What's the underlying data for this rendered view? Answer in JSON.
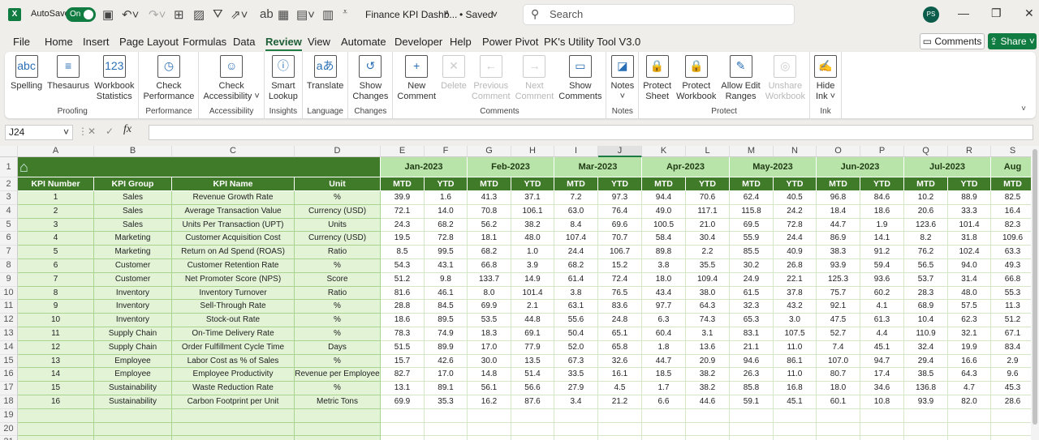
{
  "titlebar": {
    "autosave_label": "AutoSave",
    "autosave_state": "On",
    "doc_title": "Finance KPI Dashb...",
    "save_status": "• Saved",
    "search_placeholder": "Search",
    "user_initials": "PS"
  },
  "menu": [
    "File",
    "Home",
    "Insert",
    "Page Layout",
    "Formulas",
    "Data",
    "Review",
    "View",
    "Automate",
    "Developer",
    "Help",
    "Power Pivot",
    "PK's Utility Tool V3.0"
  ],
  "active_menu": "Review",
  "header_buttons": {
    "comments": "Comments",
    "share": "Share"
  },
  "ribbon": [
    {
      "label": "Proofing",
      "buttons": [
        {
          "name": "spelling",
          "text": "Spelling",
          "icon": "abc-check-icon",
          "glyph": "abc"
        },
        {
          "name": "thesaurus",
          "text": "Thesaurus",
          "icon": "book-icon",
          "glyph": "≡"
        },
        {
          "name": "workbook-statistics",
          "text": "Workbook\nStatistics",
          "icon": "statistics-icon",
          "glyph": "123"
        }
      ]
    },
    {
      "label": "Performance",
      "buttons": [
        {
          "name": "check-performance",
          "text": "Check\nPerformance",
          "icon": "grid-clock-icon",
          "glyph": "◷"
        }
      ]
    },
    {
      "label": "Accessibility",
      "buttons": [
        {
          "name": "check-accessibility",
          "text": "Check\nAccessibility ˅",
          "icon": "accessibility-icon",
          "glyph": "☺"
        }
      ]
    },
    {
      "label": "Insights",
      "buttons": [
        {
          "name": "smart-lookup",
          "text": "Smart\nLookup",
          "icon": "search-info-icon",
          "glyph": "ⓘ"
        }
      ]
    },
    {
      "label": "Language",
      "buttons": [
        {
          "name": "translate",
          "text": "Translate",
          "icon": "translate-icon",
          "glyph": "aあ"
        }
      ]
    },
    {
      "label": "Changes",
      "buttons": [
        {
          "name": "show-changes",
          "text": "Show\nChanges",
          "icon": "grid-history-icon",
          "glyph": "↺"
        }
      ]
    },
    {
      "label": "Comments",
      "buttons": [
        {
          "name": "new-comment",
          "text": "New\nComment",
          "icon": "new-comment-icon",
          "glyph": "+"
        },
        {
          "name": "delete-comment",
          "text": "Delete",
          "icon": "delete-comment-icon",
          "glyph": "✕",
          "disabled": true
        },
        {
          "name": "previous-comment",
          "text": "Previous\nComment",
          "icon": "previous-comment-icon",
          "glyph": "←",
          "disabled": true
        },
        {
          "name": "next-comment",
          "text": "Next\nComment",
          "icon": "next-comment-icon",
          "glyph": "→",
          "disabled": true
        },
        {
          "name": "show-comments",
          "text": "Show\nComments",
          "icon": "comments-icon",
          "glyph": "▭"
        }
      ]
    },
    {
      "label": "Notes",
      "buttons": [
        {
          "name": "notes",
          "text": "Notes\n˅",
          "icon": "note-icon",
          "glyph": "◪"
        }
      ]
    },
    {
      "label": "Protect",
      "buttons": [
        {
          "name": "protect-sheet",
          "text": "Protect\nSheet",
          "icon": "lock-sheet-icon",
          "glyph": "🔒"
        },
        {
          "name": "protect-workbook",
          "text": "Protect\nWorkbook",
          "icon": "lock-workbook-icon",
          "glyph": "🔒"
        },
        {
          "name": "allow-edit-ranges",
          "text": "Allow Edit\nRanges",
          "icon": "pencil-grid-icon",
          "glyph": "✎"
        },
        {
          "name": "unshare-workbook",
          "text": "Unshare\nWorkbook",
          "icon": "unshare-icon",
          "glyph": "◎",
          "disabled": true
        }
      ]
    },
    {
      "label": "Ink",
      "buttons": [
        {
          "name": "hide-ink",
          "text": "Hide\nInk ˅",
          "icon": "ink-icon",
          "glyph": "✍"
        }
      ]
    }
  ],
  "formula_bar": {
    "name_box": "J24",
    "fx_label": "fx",
    "value": ""
  },
  "columns": [
    "A",
    "B",
    "C",
    "D",
    "E",
    "F",
    "G",
    "H",
    "I",
    "J",
    "K",
    "L",
    "M",
    "N",
    "O",
    "P",
    "Q",
    "R",
    "S"
  ],
  "selected_column": "J",
  "table": {
    "headers": [
      "KPI Number",
      "KPI Group",
      "KPI Name",
      "Unit"
    ],
    "months": [
      "Jan-2023",
      "Feb-2023",
      "Mar-2023",
      "Apr-2023",
      "May-2023",
      "Jun-2023",
      "Jul-2023",
      "Aug"
    ],
    "sub_headers": [
      "MTD",
      "YTD"
    ],
    "rows": [
      {
        "num": "1",
        "group": "Sales",
        "name": "Revenue Growth Rate",
        "unit": "%",
        "values": [
          "39.9",
          "1.6",
          "41.3",
          "37.1",
          "7.2",
          "97.3",
          "94.4",
          "70.6",
          "62.4",
          "40.5",
          "96.8",
          "84.6",
          "10.2",
          "88.9",
          "82.5"
        ]
      },
      {
        "num": "2",
        "group": "Sales",
        "name": "Average Transaction Value",
        "unit": "Currency (USD)",
        "values": [
          "72.1",
          "14.0",
          "70.8",
          "106.1",
          "63.0",
          "76.4",
          "49.0",
          "117.1",
          "115.8",
          "24.2",
          "18.4",
          "18.6",
          "20.6",
          "33.3",
          "16.4"
        ]
      },
      {
        "num": "3",
        "group": "Sales",
        "name": "Units Per Transaction (UPT)",
        "unit": "Units",
        "values": [
          "24.3",
          "68.2",
          "56.2",
          "38.2",
          "8.4",
          "69.6",
          "100.5",
          "21.0",
          "69.5",
          "72.8",
          "44.7",
          "1.9",
          "123.6",
          "101.4",
          "82.3"
        ]
      },
      {
        "num": "4",
        "group": "Marketing",
        "name": "Customer Acquisition Cost",
        "unit": "Currency (USD)",
        "values": [
          "19.5",
          "72.8",
          "18.1",
          "48.0",
          "107.4",
          "70.7",
          "58.4",
          "30.4",
          "55.9",
          "24.4",
          "86.9",
          "14.1",
          "8.2",
          "31.8",
          "109.6"
        ]
      },
      {
        "num": "5",
        "group": "Marketing",
        "name": "Return on Ad Spend (ROAS)",
        "unit": "Ratio",
        "values": [
          "8.5",
          "99.5",
          "68.2",
          "1.0",
          "24.4",
          "106.7",
          "89.8",
          "2.2",
          "85.5",
          "40.9",
          "38.3",
          "91.2",
          "76.2",
          "102.4",
          "63.3"
        ]
      },
      {
        "num": "6",
        "group": "Customer",
        "name": "Customer Retention Rate",
        "unit": "%",
        "values": [
          "54.3",
          "43.1",
          "66.8",
          "3.9",
          "68.2",
          "15.2",
          "3.8",
          "35.5",
          "30.2",
          "26.8",
          "93.9",
          "59.4",
          "56.5",
          "94.0",
          "49.3"
        ]
      },
      {
        "num": "7",
        "group": "Customer",
        "name": "Net Promoter Score (NPS)",
        "unit": "Score",
        "values": [
          "51.2",
          "9.8",
          "133.7",
          "14.9",
          "61.4",
          "72.4",
          "18.0",
          "109.4",
          "24.9",
          "22.1",
          "125.3",
          "93.6",
          "53.7",
          "31.4",
          "66.8"
        ]
      },
      {
        "num": "8",
        "group": "Inventory",
        "name": "Inventory Turnover",
        "unit": "Ratio",
        "values": [
          "81.6",
          "46.1",
          "8.0",
          "101.4",
          "3.8",
          "76.5",
          "43.4",
          "38.0",
          "61.5",
          "37.8",
          "75.7",
          "60.2",
          "28.3",
          "48.0",
          "55.3"
        ]
      },
      {
        "num": "9",
        "group": "Inventory",
        "name": "Sell-Through Rate",
        "unit": "%",
        "values": [
          "28.8",
          "84.5",
          "69.9",
          "2.1",
          "63.1",
          "83.6",
          "97.7",
          "64.3",
          "32.3",
          "43.2",
          "92.1",
          "4.1",
          "68.9",
          "57.5",
          "11.3"
        ]
      },
      {
        "num": "10",
        "group": "Inventory",
        "name": "Stock-out Rate",
        "unit": "%",
        "values": [
          "18.6",
          "89.5",
          "53.5",
          "44.8",
          "55.6",
          "24.8",
          "6.3",
          "74.3",
          "65.3",
          "3.0",
          "47.5",
          "61.3",
          "10.4",
          "62.3",
          "51.2"
        ]
      },
      {
        "num": "11",
        "group": "Supply Chain",
        "name": "On-Time Delivery Rate",
        "unit": "%",
        "values": [
          "78.3",
          "74.9",
          "18.3",
          "69.1",
          "50.4",
          "65.1",
          "60.4",
          "3.1",
          "83.1",
          "107.5",
          "52.7",
          "4.4",
          "110.9",
          "32.1",
          "67.1"
        ]
      },
      {
        "num": "12",
        "group": "Supply Chain",
        "name": "Order Fulfillment Cycle Time",
        "unit": "Days",
        "values": [
          "51.5",
          "89.9",
          "17.0",
          "77.9",
          "52.0",
          "65.8",
          "1.8",
          "13.6",
          "21.1",
          "11.0",
          "7.4",
          "45.1",
          "32.4",
          "19.9",
          "83.4"
        ]
      },
      {
        "num": "13",
        "group": "Employee",
        "name": "Labor Cost as % of Sales",
        "unit": "%",
        "values": [
          "15.7",
          "42.6",
          "30.0",
          "13.5",
          "67.3",
          "32.6",
          "44.7",
          "20.9",
          "94.6",
          "86.1",
          "107.0",
          "94.7",
          "29.4",
          "16.6",
          "2.9"
        ]
      },
      {
        "num": "14",
        "group": "Employee",
        "name": "Employee Productivity",
        "unit": "Revenue per Employee",
        "values": [
          "82.7",
          "17.0",
          "14.8",
          "51.4",
          "33.5",
          "16.1",
          "18.5",
          "38.2",
          "26.3",
          "11.0",
          "80.7",
          "17.4",
          "38.5",
          "64.3",
          "9.6"
        ]
      },
      {
        "num": "15",
        "group": "Sustainability",
        "name": "Waste Reduction Rate",
        "unit": "%",
        "values": [
          "13.1",
          "89.1",
          "56.1",
          "56.6",
          "27.9",
          "4.5",
          "1.7",
          "38.2",
          "85.8",
          "16.8",
          "18.0",
          "34.6",
          "136.8",
          "4.7",
          "45.3"
        ]
      },
      {
        "num": "16",
        "group": "Sustainability",
        "name": "Carbon Footprint per Unit",
        "unit": "Metric Tons",
        "values": [
          "69.9",
          "35.3",
          "16.2",
          "87.6",
          "3.4",
          "21.2",
          "6.6",
          "44.6",
          "59.1",
          "45.1",
          "60.1",
          "10.8",
          "93.9",
          "82.0",
          "28.6"
        ]
      }
    ]
  },
  "colors": {
    "header_dark_green": "#3f7b28",
    "month_green": "#b9e4a9",
    "kpi_cell_green": "#e2f3d6",
    "excel_green": "#107c41"
  },
  "icons": {
    "home": "home-icon"
  }
}
